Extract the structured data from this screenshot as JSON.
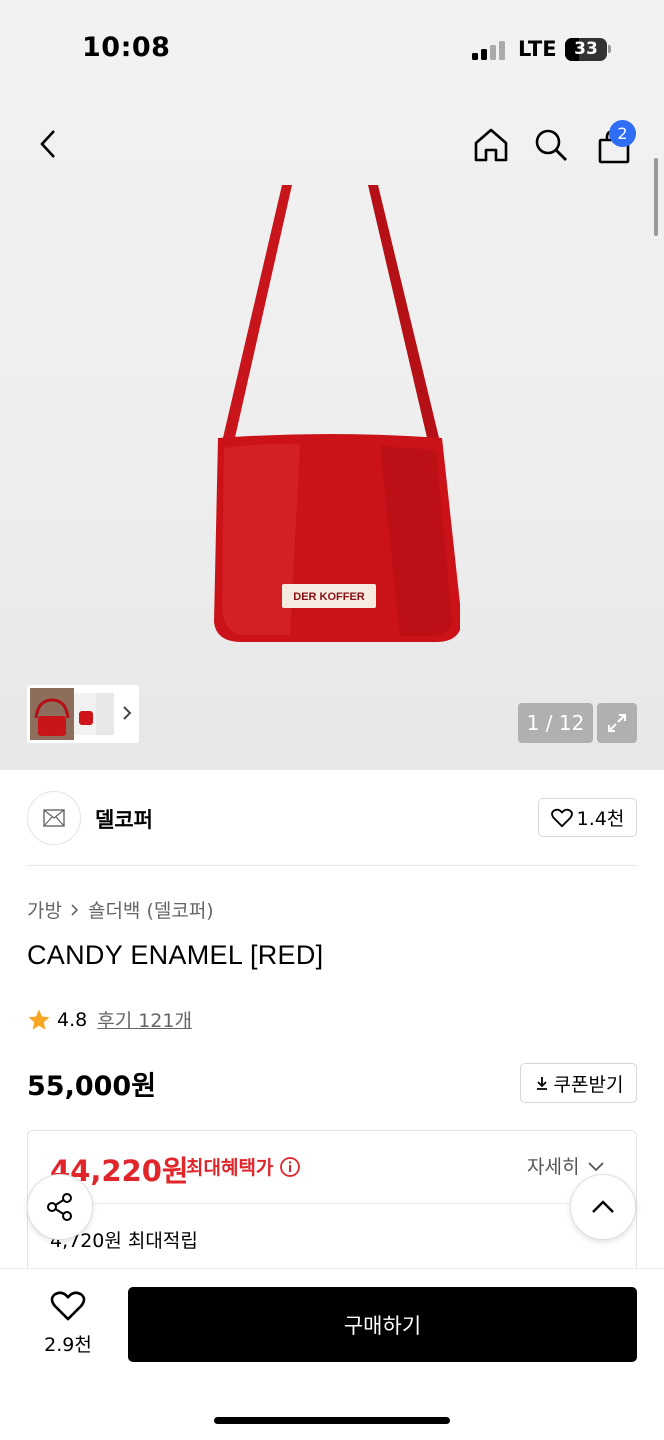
{
  "status_bar": {
    "time": "10:08",
    "network": "LTE",
    "battery": "33"
  },
  "header": {
    "cart_count": "2"
  },
  "gallery": {
    "counter": "1 / 12",
    "label_on_bag": "DER KOFFER"
  },
  "brand": {
    "name": "델코퍼",
    "like_count": "1.4천"
  },
  "breadcrumb": {
    "category": "가방",
    "subcategory": "숄더백 (델코퍼)"
  },
  "product": {
    "title": "CANDY ENAMEL [RED]",
    "rating": "4.8",
    "review_link": "후기 121개",
    "price": "55,000원",
    "coupon_label": "쿠폰받기"
  },
  "benefit": {
    "sale_price": "44,220원",
    "sale_label": "최대혜택가",
    "detail_label": "자세히",
    "points": "4,720원 최대적립"
  },
  "bottom_bar": {
    "wish_count": "2.9천",
    "buy_label": "구매하기"
  },
  "colors": {
    "accent_red": "#e0262b",
    "badge_blue": "#2f6df5",
    "bag_red": "#c8141b",
    "star": "#f5a623"
  }
}
